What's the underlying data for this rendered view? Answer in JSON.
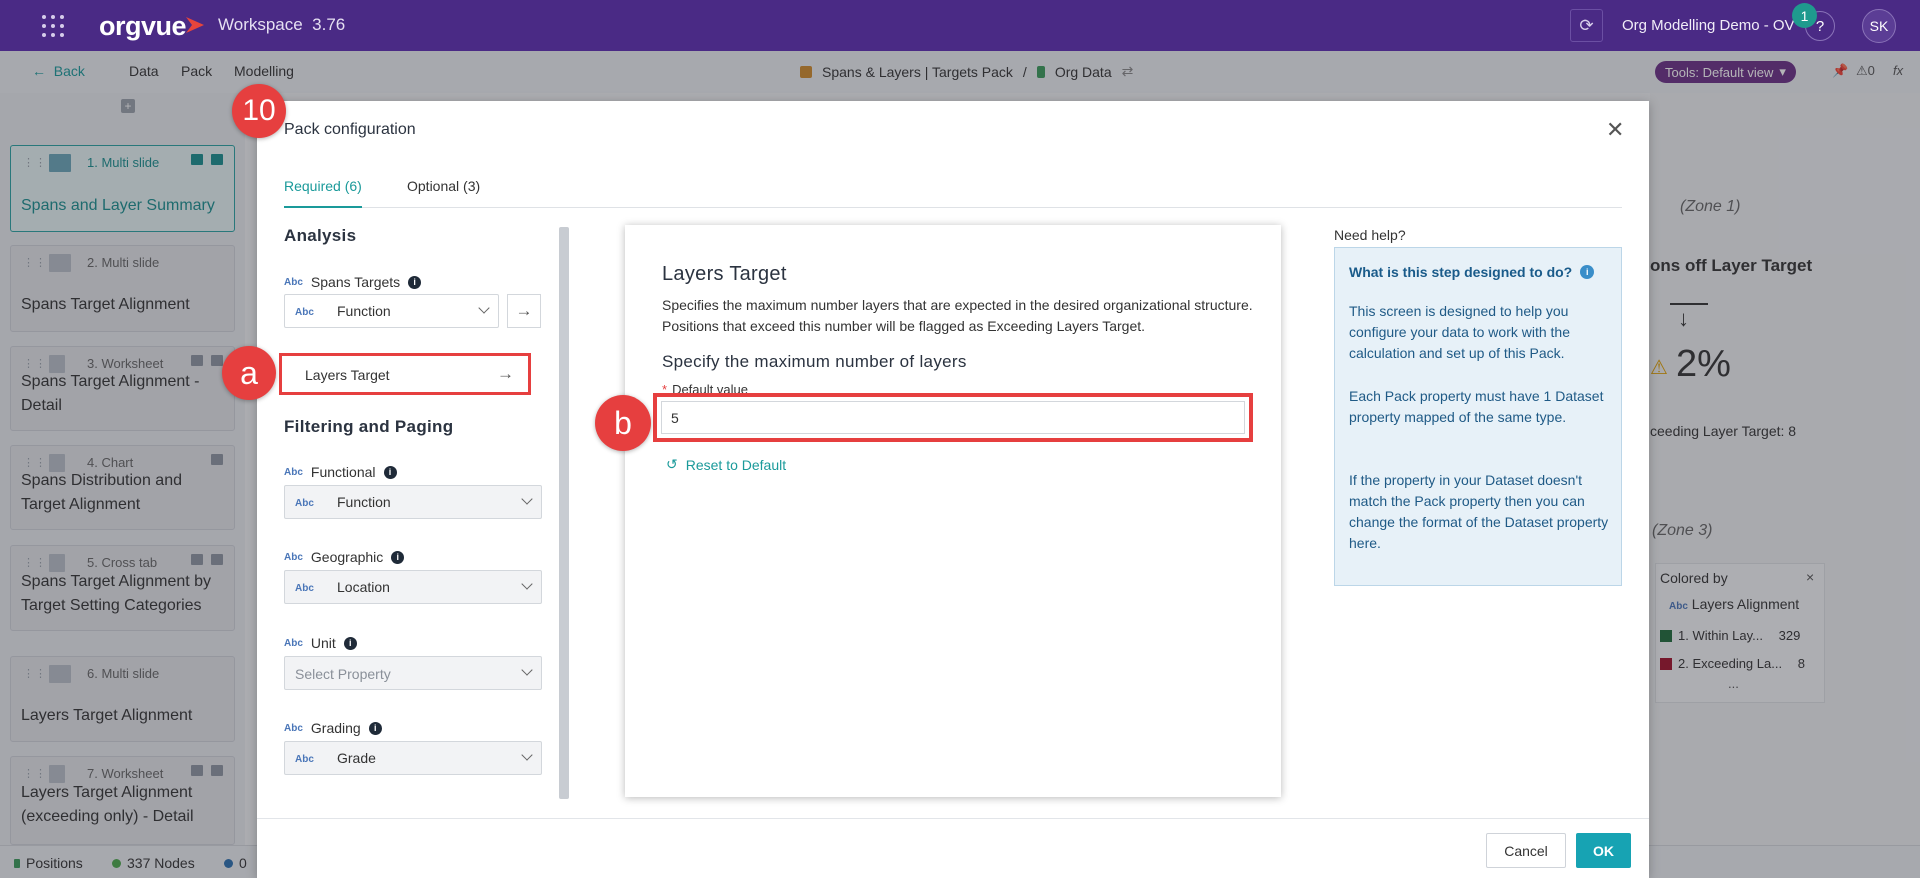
{
  "topbar": {
    "logo_text": "orgvue",
    "workspace_title": "Workspace",
    "version": "3.76",
    "project_name": "Org Modelling Demo - OV",
    "notifications": "1",
    "help_label": "?",
    "user_initials": "SK"
  },
  "navbar": {
    "back_label": "Back",
    "items": [
      "Data",
      "Pack",
      "Modelling"
    ],
    "breadcrumb_pack": "Spans & Layers | Targets Pack",
    "breadcrumb_sep": "/",
    "breadcrumb_data": "Org Data",
    "tools_label": "Tools: Default view",
    "alerts_count": "0"
  },
  "slides": [
    {
      "num": "1. Multi slide",
      "title": "Spans and Layer Summary",
      "active": true
    },
    {
      "num": "2. Multi slide",
      "title": "Spans Target Alignment"
    },
    {
      "num": "3. Worksheet",
      "title": "Spans Target Alignment - Detail"
    },
    {
      "num": "4. Chart",
      "title": "Spans Distribution and Target Alignment"
    },
    {
      "num": "5. Cross tab",
      "title": "Spans Target Alignment by Target Setting Categories"
    },
    {
      "num": "6. Multi slide",
      "title": "Layers Target Alignment"
    },
    {
      "num": "7. Worksheet",
      "title": "Layers Target Alignment (exceeding only) - Detail"
    }
  ],
  "right_bg": {
    "zone1": "(Zone 1)",
    "zone1_title": "ons off Layer Target",
    "zone1_value": "2%",
    "zone1_caption": "ceeding Layer Target: 8",
    "zone3": "(Zone 3)",
    "colored_by": "Colored by",
    "legend_prop": "Layers Alignment",
    "legend": [
      {
        "label": "1. Within Lay...",
        "count": "329",
        "color": "#1e6b3a"
      },
      {
        "label": "2. Exceeding La...",
        "count": "8",
        "color": "#a0102a"
      }
    ],
    "more": "..."
  },
  "statusbar": {
    "positions": "Positions",
    "nodes": "337 Nodes",
    "extra": "0"
  },
  "modal": {
    "title": "Pack configuration",
    "tabs": [
      {
        "label": "Required (6)",
        "active": true
      },
      {
        "label": "Optional (3)",
        "active": false
      }
    ],
    "analysis_heading": "Analysis",
    "spans_targets_label": "Spans Targets",
    "spans_targets_value": "Function",
    "layers_target_label": "Layers Target",
    "filtering_heading": "Filtering and Paging",
    "functional_label": "Functional",
    "functional_value": "Function",
    "geographic_label": "Geographic",
    "geographic_value": "Location",
    "unit_label": "Unit",
    "unit_placeholder": "Select Property",
    "grading_label": "Grading",
    "grading_value": "Grade",
    "abc": "Abc",
    "card": {
      "title": "Layers Target",
      "description": "Specifies the maximum number layers that are expected in the desired organizational structure. Positions that exceed this number will be flagged as Exceeding Layers Target.",
      "subtitle": "Specify the maximum number of layers",
      "field_label": "Default value",
      "field_value": "5",
      "reset_label": "Reset to Default"
    },
    "help": {
      "title": "Need help?",
      "question": "What is this step designed to do?",
      "p1": "This screen is designed to help you configure your data to work with the calculation and set up of this Pack.",
      "p2": "Each Pack property must have 1 Dataset property mapped of the same type.",
      "p3": "If the property in your Dataset doesn't match the Pack property then you can change the format of the Dataset property here."
    },
    "cancel_label": "Cancel",
    "ok_label": "OK"
  },
  "markers": {
    "step": "10",
    "a": "a",
    "b": "b"
  }
}
